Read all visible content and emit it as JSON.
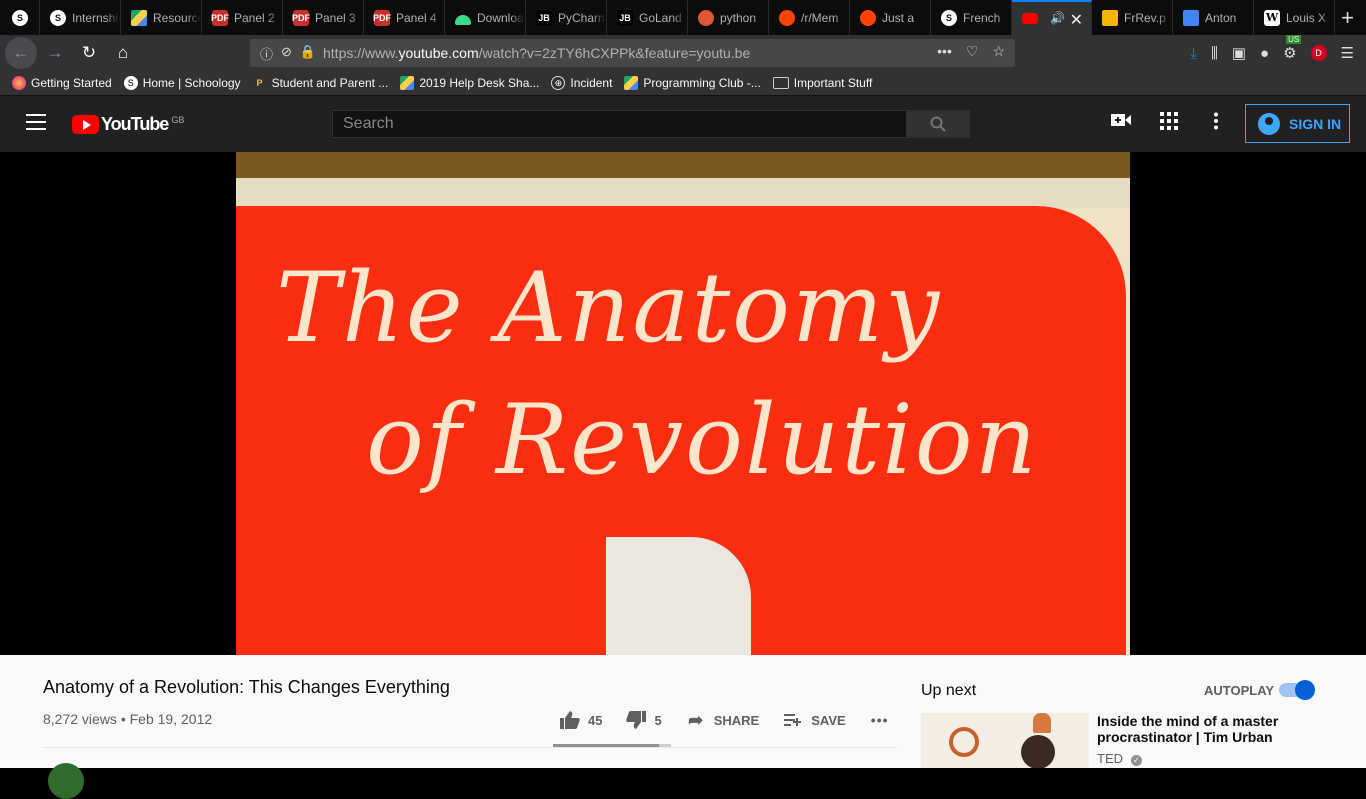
{
  "browser": {
    "tabs": [
      {
        "label": "",
        "icon": "schoology-icon"
      },
      {
        "label": "Internship",
        "icon": "schoology-icon"
      },
      {
        "label": "Resources",
        "icon": "google-drive-icon"
      },
      {
        "label": "Panel 2",
        "icon": "pdf-icon"
      },
      {
        "label": "Panel 3",
        "icon": "pdf-icon"
      },
      {
        "label": "Panel 4",
        "icon": "pdf-icon"
      },
      {
        "label": "Downloads",
        "icon": "android-icon"
      },
      {
        "label": "PyCharm",
        "icon": "jetbrains-icon"
      },
      {
        "label": "GoLand",
        "icon": "jetbrains-icon"
      },
      {
        "label": "python",
        "icon": "duckduckgo-icon"
      },
      {
        "label": "/r/Mem",
        "icon": "reddit-icon"
      },
      {
        "label": "Just a",
        "icon": "reddit-icon"
      },
      {
        "label": "French",
        "icon": "schoology-icon"
      },
      {
        "label": "",
        "icon": "youtube-icon",
        "active": true
      },
      {
        "label": "FrRev.p",
        "icon": "slides-icon"
      },
      {
        "label": "Anton",
        "icon": "docs-icon"
      },
      {
        "label": "Louis X",
        "icon": "wikipedia-icon"
      }
    ],
    "url_prefix": "https://www.",
    "url_domain": "youtube.com",
    "url_suffix": "/watch?v=2zTY6hCXPPk&feature=youtu.be",
    "extension_badges": {
      "us": "US",
      "profile": "D"
    },
    "bookmarks": [
      {
        "label": "Getting Started",
        "icon": "firefox-icon"
      },
      {
        "label": "Home | Schoology",
        "icon": "schoology-icon"
      },
      {
        "label": "Student and Parent ...",
        "icon": "p-icon"
      },
      {
        "label": "2019 Help Desk Sha...",
        "icon": "google-drive-icon"
      },
      {
        "label": "Incident",
        "icon": "globe-icon"
      },
      {
        "label": "Programming Club -...",
        "icon": "google-drive-icon"
      },
      {
        "label": "Important Stuff",
        "icon": "folder-icon"
      }
    ]
  },
  "youtube": {
    "logo_text": "YouTube",
    "region": "GB",
    "search_placeholder": "Search",
    "signin_label": "SIGN IN"
  },
  "video": {
    "title": "Anatomy of a Revolution: This Changes Everything",
    "views": "8,272 views",
    "date": "Feb 19, 2012",
    "likes": "45",
    "dislikes": "5",
    "like_ratio": 0.9,
    "share_label": "SHARE",
    "save_label": "SAVE",
    "frame_text_line1": "The Anatomy",
    "frame_text_line2": "of Revolution"
  },
  "sidebar": {
    "up_next_label": "Up next",
    "autoplay_label": "AUTOPLAY",
    "autoplay_on": true,
    "recommendation": {
      "title": "Inside the mind of a master procrastinator | Tim Urban",
      "channel": "TED"
    }
  },
  "colors": {
    "youtube_red": "#ff0000",
    "signin_blue": "#3ea6ff",
    "toggle_blue": "#065fd4",
    "firefox_accent": "#0a84ff"
  }
}
